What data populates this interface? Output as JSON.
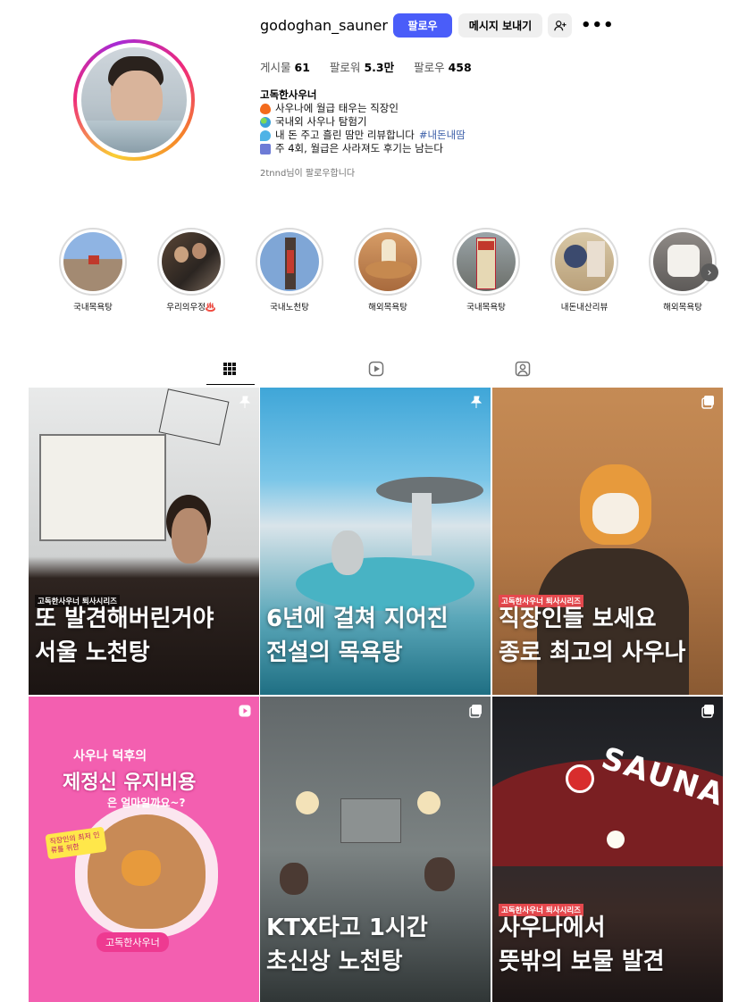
{
  "profile": {
    "username": "godoghan_sauner",
    "follow_label": "팔로우",
    "message_label": "메시지 보내기",
    "stats": [
      {
        "label": "게시물",
        "value": "61"
      },
      {
        "label": "팔로워",
        "value": "5.3만"
      },
      {
        "label": "팔로우",
        "value": "458"
      }
    ],
    "full_name": "고독한사우너",
    "bio": [
      {
        "icon": "fire-icon",
        "color": "#f36b1c",
        "text": "사우나에 월급 태우는 직장인",
        "tag": ""
      },
      {
        "icon": "globe-icon",
        "color": "#3aa0d8",
        "text": "국내외 사우나 탐험기",
        "tag": ""
      },
      {
        "icon": "sweat-drops-icon",
        "color": "#4fb3e6",
        "text": "내 돈 주고 흘린 땀만 리뷰합니다 ",
        "tag": "#내돈내땀"
      },
      {
        "icon": "calendar-icon",
        "color": "#6d7bd6",
        "text": "주 4회, 월급은 사라져도 후기는 남는다",
        "tag": ""
      }
    ],
    "followed_by_user": "2tnnd",
    "followed_by_suffix": "님이 팔로우합니다"
  },
  "highlights": [
    {
      "label": "국내목욕탕"
    },
    {
      "label": "우리의우정♨️"
    },
    {
      "label": "국내노천탕"
    },
    {
      "label": "해외목욕탕"
    },
    {
      "label": "국내목욕탕"
    },
    {
      "label": "내돈내산리뷰"
    },
    {
      "label": "해외목욕탕"
    }
  ],
  "tabs": [
    {
      "name": "posts",
      "icon": "grid-icon",
      "active": true
    },
    {
      "name": "reels",
      "icon": "reels-icon",
      "active": false
    },
    {
      "name": "tagged",
      "icon": "tagged-icon",
      "active": false
    }
  ],
  "posts": [
    {
      "series": "고독한사우너 퇴사시리즈",
      "line1": "또 발견해버린거야",
      "line2": "서울 노천탕",
      "badge": "pin-icon"
    },
    {
      "series": "",
      "line1": "6년에 걸쳐 지어진",
      "line2": "전설의 목욕탕",
      "badge": "pin-icon"
    },
    {
      "series": "고독한사우너 퇴사시리즈",
      "line1": "직장인들 보세요",
      "line2": "종로 최고의 사우나",
      "badge": "carousel-icon"
    },
    {
      "series": "",
      "line1": "",
      "line2": "",
      "badge": "reel-icon",
      "art_title_top": "사우나 덕후의",
      "art_title_main": "제정신 유지비용",
      "art_title_sub": "은 얼마일까요~?",
      "art_sticker": "직장인의 최저 인류를 위한",
      "art_name": "고독한사우너"
    },
    {
      "series": "",
      "line1": "KTX타고 1시간",
      "line2": "초신상 노천탕",
      "badge": "carousel-icon"
    },
    {
      "series": "고독한사우너 퇴사시리즈",
      "line1": "사우나에서",
      "line2": "뜻밖의 보물 발견",
      "badge": "carousel-icon",
      "sign": "SAUNA"
    }
  ]
}
